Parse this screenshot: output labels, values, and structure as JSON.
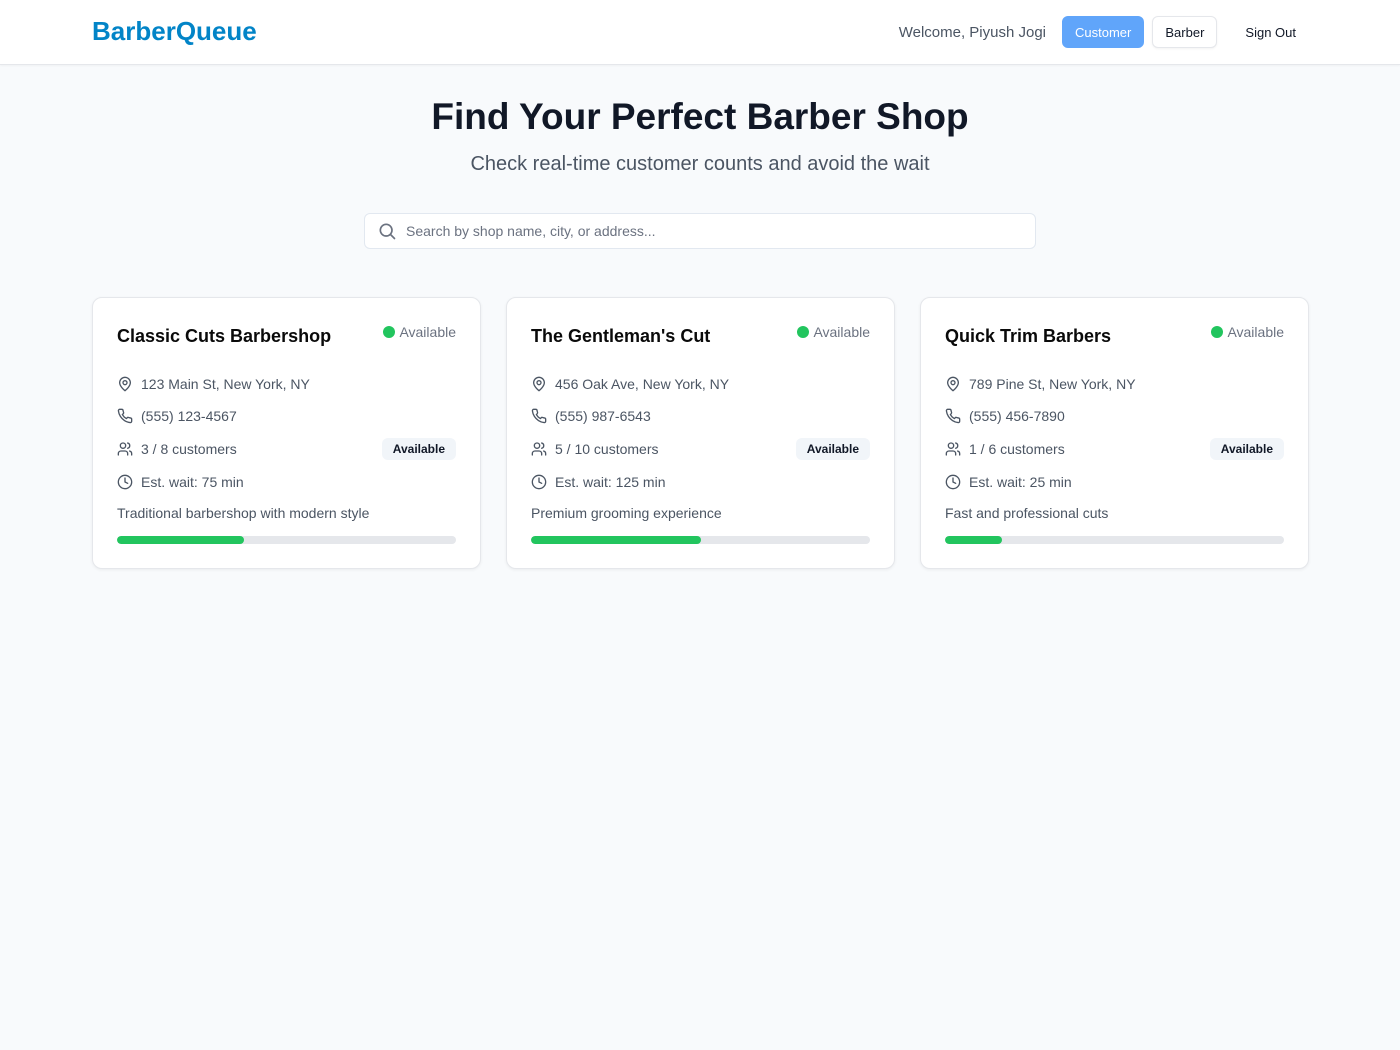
{
  "header": {
    "brand": "BarberQueue",
    "welcome": "Welcome, Piyush Jogi",
    "customer_label": "Customer",
    "barber_label": "Barber",
    "signout_label": "Sign Out"
  },
  "hero": {
    "title": "Find Your Perfect Barber Shop",
    "subtitle": "Check real-time customer counts and avoid the wait"
  },
  "search": {
    "placeholder": "Search by shop name, city, or address...",
    "value": ""
  },
  "colors": {
    "brand": "#0284c7",
    "available": "#22c55e",
    "customer_button": "#60a5fa"
  },
  "shops": [
    {
      "name": "Classic Cuts Barbershop",
      "status": "Available",
      "address": "123 Main St, New York, NY",
      "phone": "(555) 123-4567",
      "customers": "3 / 8 customers",
      "badge": "Available",
      "wait": "Est. wait: 75 min",
      "description": "Traditional barbershop with modern style",
      "occupancy": 0.375
    },
    {
      "name": "The Gentleman's Cut",
      "status": "Available",
      "address": "456 Oak Ave, New York, NY",
      "phone": "(555) 987-6543",
      "customers": "5 / 10 customers",
      "badge": "Available",
      "wait": "Est. wait: 125 min",
      "description": "Premium grooming experience",
      "occupancy": 0.5
    },
    {
      "name": "Quick Trim Barbers",
      "status": "Available",
      "address": "789 Pine St, New York, NY",
      "phone": "(555) 456-7890",
      "customers": "1 / 6 customers",
      "badge": "Available",
      "wait": "Est. wait: 25 min",
      "description": "Fast and professional cuts",
      "occupancy": 0.1667
    }
  ]
}
